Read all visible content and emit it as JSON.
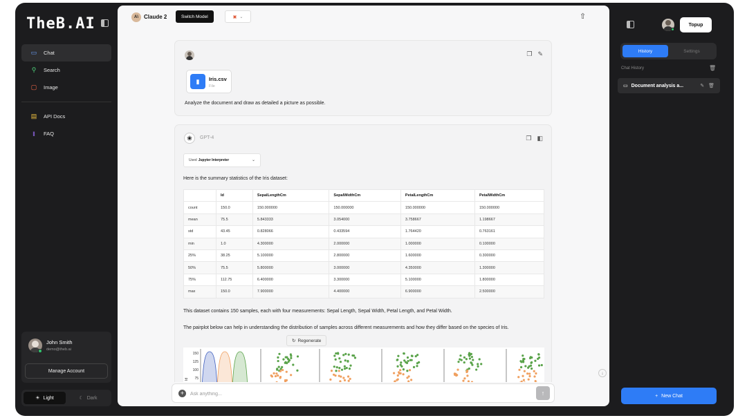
{
  "sidebar": {
    "logo": "TheB.AI",
    "items": [
      {
        "label": "Chat",
        "icon": "chat-icon"
      },
      {
        "label": "Search",
        "icon": "search-icon"
      },
      {
        "label": "Image",
        "icon": "image-icon"
      }
    ],
    "items2": [
      {
        "label": "API Docs",
        "icon": "docs-icon"
      },
      {
        "label": "FAQ",
        "icon": "waveform-icon"
      }
    ],
    "user": {
      "name": "John Smith",
      "email": "demo@theb.ai"
    },
    "manage_label": "Manage Account",
    "theme": {
      "light": "Light",
      "dark": "Dark"
    }
  },
  "topbar": {
    "model_name": "Claude 2",
    "model_initials": "A\\",
    "switch_label": "Switch Model"
  },
  "user_message": {
    "file_name": "Iris.csv",
    "file_type": "File",
    "text": "Analyze the document and draw as detailed a picture as possible."
  },
  "bot_message": {
    "model": "GPT-4",
    "tool_prefix": "Used",
    "tool_name": "Jupyter Interpreter",
    "summary": "Here is the summary statistics of the Iris dataset:",
    "table": {
      "headers": [
        "",
        "Id",
        "SepalLengthCm",
        "SepalWidthCm",
        "PetalLengthCm",
        "PetalWidthCm"
      ],
      "rows": [
        [
          "count",
          "150.0",
          "150.000000",
          "150.000000",
          "150.000000",
          "150.000000"
        ],
        [
          "mean",
          "75.5",
          "5.843333",
          "3.054000",
          "3.758667",
          "1.198667"
        ],
        [
          "std",
          "43.45",
          "0.828066",
          "0.433594",
          "1.764420",
          "0.763161"
        ],
        [
          "min",
          "1.0",
          "4.300000",
          "2.000000",
          "1.000000",
          "0.100000"
        ],
        [
          "25%",
          "38.25",
          "5.100000",
          "2.800000",
          "1.600000",
          "0.300000"
        ],
        [
          "50%",
          "75.5",
          "5.800000",
          "3.000000",
          "4.350000",
          "1.300000"
        ],
        [
          "75%",
          "112.75",
          "6.400000",
          "3.300000",
          "5.100000",
          "1.800000"
        ],
        [
          "max",
          "150.0",
          "7.900000",
          "4.400000",
          "6.900000",
          "2.500000"
        ]
      ]
    },
    "para1": "This dataset contains 150 samples, each with four measurements: Sepal Length, Sepal Width, Petal Length, and Petal Width.",
    "para2": "The pairplot below can help in understanding the distribution of samples across different measurements and how they differ based on the species of Iris.",
    "pairplot_ticks": [
      "150",
      "125",
      "100",
      "75"
    ],
    "pairplot_ylabel": "Id"
  },
  "regenerate_label": "Regenerate",
  "input": {
    "placeholder": "Ask anything..."
  },
  "right_panel": {
    "topup_label": "Topup",
    "tabs": {
      "history": "History",
      "settings": "Settings"
    },
    "chat_history_label": "Chat History",
    "history_items": [
      {
        "title": "Document analysis a..."
      }
    ],
    "new_chat_label": "New Chat"
  },
  "colors": {
    "accent": "#2e7cf6",
    "sidebar_bg": "#1c1c1e",
    "main_bg": "#f7f7f8",
    "online": "#33c46e",
    "series_a": "#3f5fbf",
    "series_b": "#f0a060",
    "series_c": "#5aa34a"
  }
}
